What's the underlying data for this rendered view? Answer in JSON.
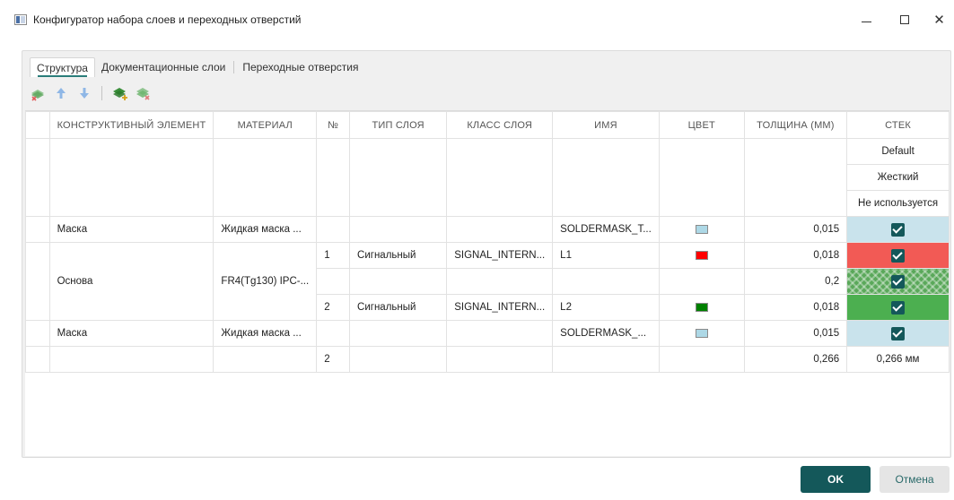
{
  "window": {
    "title": "Конфигуратор набора слоев и переходных отверстий",
    "minimize_glyph": "",
    "maximize_glyph": "",
    "close_glyph": "✕"
  },
  "tabs": [
    {
      "label": "Структура",
      "active": true
    },
    {
      "label": "Документационные слои",
      "active": false
    },
    {
      "label": "Переходные отверстия",
      "active": false
    }
  ],
  "toolbar": {
    "icons": [
      "remove-layer-icon",
      "move-up-icon",
      "move-down-icon",
      "add-stack-icon",
      "remove-stack-icon"
    ]
  },
  "table": {
    "headers": {
      "element": "КОНСТРУКТИВНЫЙ ЭЛЕМЕНТ",
      "material": "МАТЕРИАЛ",
      "num": "№",
      "layer_type": "ТИП СЛОЯ",
      "layer_class": "КЛАСС СЛОЯ",
      "name": "ИМЯ",
      "color": "ЦВЕТ",
      "thickness": "ТОЛЩИНА (ММ)",
      "stack": "СТЕК"
    },
    "stack_header_rows": [
      "Default",
      "Жесткий",
      "Не используется"
    ],
    "rows": [
      {
        "element": "Маска",
        "material": "Жидкая маска ...",
        "num": "",
        "layer_type": "",
        "layer_class": "",
        "name": "SOLDERMASK_T...",
        "color": "#add8e6",
        "thickness": "0,015",
        "stack": "blue"
      },
      {
        "element": "Основа",
        "material": "FR4(Tg130) IPC-...",
        "num": "1",
        "layer_type": "Сигнальный",
        "layer_class": "SIGNAL_INTERN...",
        "name": "L1",
        "color": "#ff0000",
        "thickness": "0,018",
        "stack": "red"
      },
      {
        "element": "",
        "material": "",
        "num": "",
        "layer_type": "",
        "layer_class": "",
        "name": "",
        "color": "",
        "thickness": "0,2",
        "stack": "hatch"
      },
      {
        "element": "",
        "material": "",
        "num": "2",
        "layer_type": "Сигнальный",
        "layer_class": "SIGNAL_INTERN...",
        "name": "L2",
        "color": "#008000",
        "thickness": "0,018",
        "stack": "green"
      },
      {
        "element": "Маска",
        "material": "Жидкая маска ...",
        "num": "",
        "layer_type": "",
        "layer_class": "",
        "name": "SOLDERMASK_...",
        "color": "#add8e6",
        "thickness": "0,015",
        "stack": "blue"
      }
    ],
    "totals": {
      "num": "2",
      "thickness": "0,266",
      "stack": "0,266 мм"
    }
  },
  "buttons": {
    "ok": "OK",
    "cancel": "Отмена"
  }
}
